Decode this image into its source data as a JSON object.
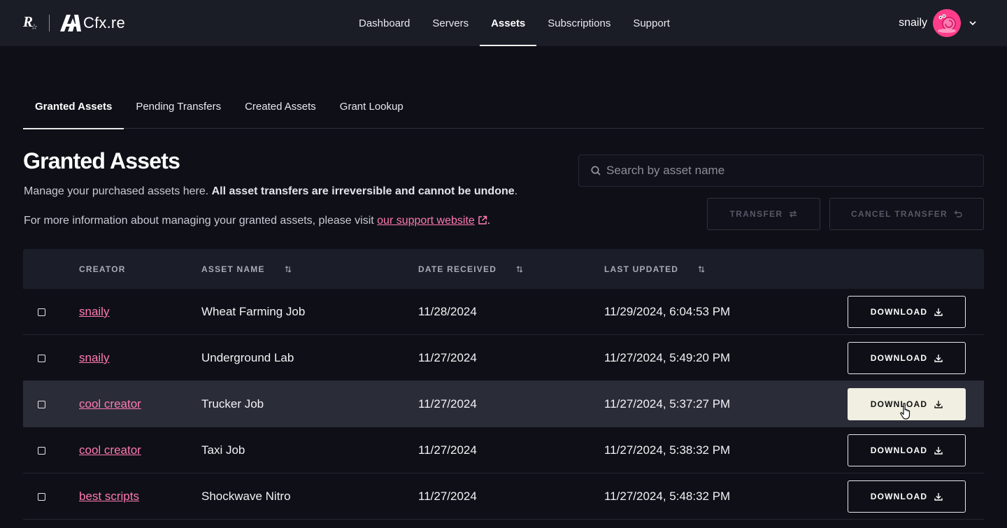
{
  "header": {
    "brand_text": "Cfx.re",
    "nav": [
      "Dashboard",
      "Servers",
      "Assets",
      "Subscriptions",
      "Support"
    ],
    "nav_active": "Assets",
    "user_name": "snaily"
  },
  "subtabs": [
    "Granted Assets",
    "Pending Transfers",
    "Created Assets",
    "Grant Lookup"
  ],
  "subtab_active": "Granted Assets",
  "page": {
    "title": "Granted Assets",
    "desc1_plain": "Manage your purchased assets here.",
    "desc1_bold": "All asset transfers are irreversible and cannot be undone",
    "desc1_end": ".",
    "desc2_plain": "For more information about managing your granted assets, please visit",
    "desc2_link": "our support website",
    "desc2_end": "."
  },
  "search": {
    "placeholder": "Search by asset name",
    "value": ""
  },
  "actions": {
    "transfer": "TRANSFER",
    "cancel_transfer": "CANCEL TRANSFER"
  },
  "table": {
    "columns": [
      "CREATOR",
      "ASSET NAME",
      "DATE RECEIVED",
      "LAST UPDATED"
    ],
    "download_label": "DOWNLOAD",
    "rows": [
      {
        "creator": "snaily",
        "asset": "Wheat Farming Job",
        "received": "11/28/2024",
        "updated": "11/29/2024, 6:04:53 PM"
      },
      {
        "creator": "snaily",
        "asset": "Underground Lab",
        "received": "11/27/2024",
        "updated": "11/27/2024, 5:49:20 PM"
      },
      {
        "creator": "cool creator",
        "asset": "Trucker Job",
        "received": "11/27/2024",
        "updated": "11/27/2024, 5:37:27 PM"
      },
      {
        "creator": "cool creator",
        "asset": "Taxi Job",
        "received": "11/27/2024",
        "updated": "11/27/2024, 5:38:32 PM"
      },
      {
        "creator": "best scripts",
        "asset": "Shockwave Nitro",
        "received": "11/27/2024",
        "updated": "11/27/2024, 5:48:32 PM"
      }
    ]
  },
  "colors": {
    "accent_pink": "#ff7ab1",
    "avatar": "#ff3d8b",
    "background": "#0f1017",
    "hover_button": "#f0efe2"
  }
}
